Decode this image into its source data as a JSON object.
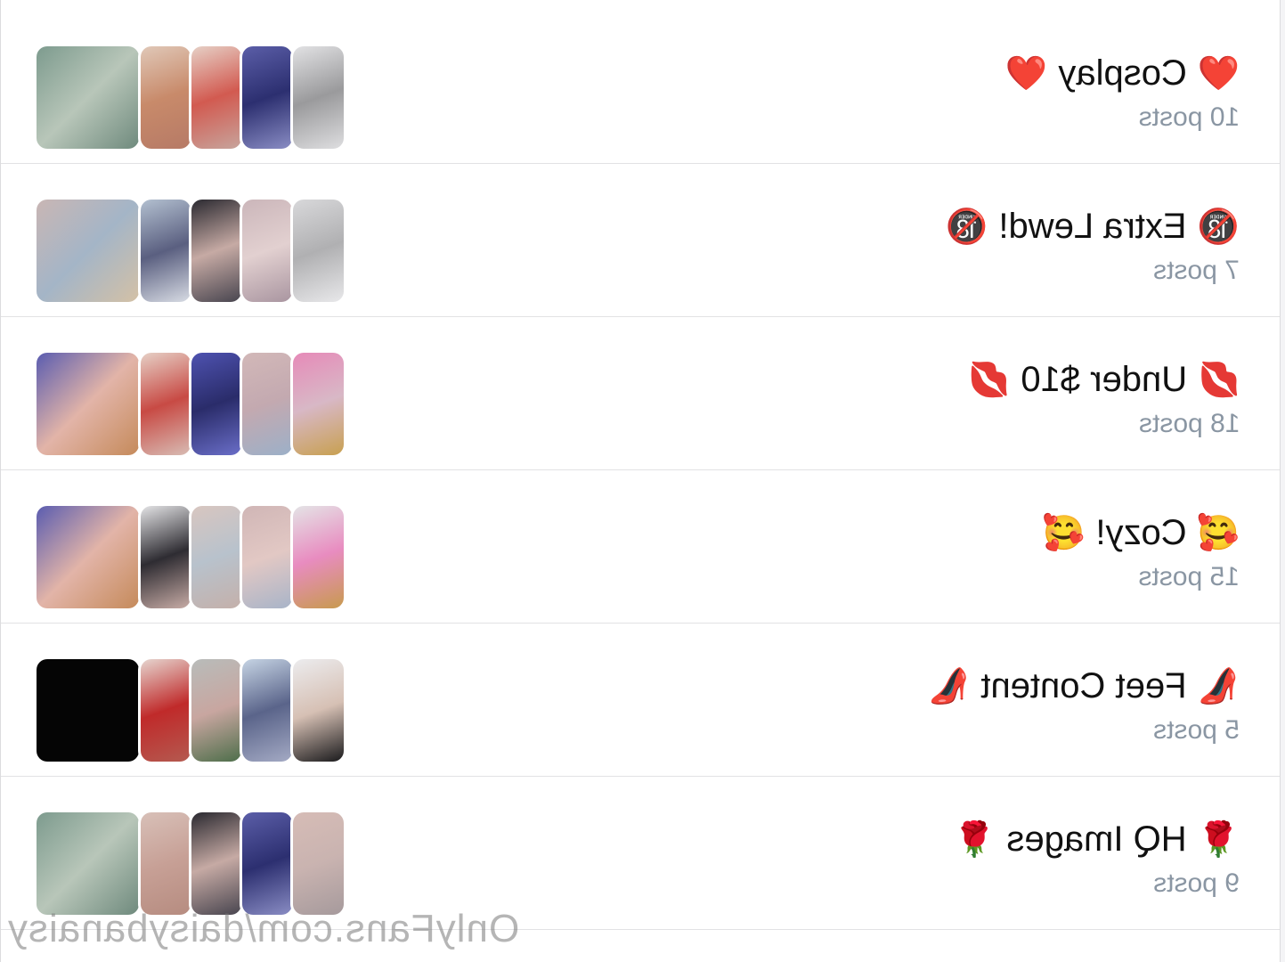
{
  "collections": [
    {
      "title": "Cosplay",
      "emoji": "❤️",
      "count": "10 posts",
      "thumbs": [
        "#8aa59a",
        "#c9a79c",
        "#d8b0a8",
        "#4a4e8a",
        "#cfcfd2"
      ]
    },
    {
      "title": "Extra Lewd!",
      "emoji": "🔞",
      "count": "7 posts",
      "thumbs": [
        "#b7a9a7",
        "#a9b4c4",
        "#3c3a44",
        "#c6b3b8",
        "#d2d2d4"
      ]
    },
    {
      "title": "Under $10",
      "emoji": "💋",
      "count": "18 posts",
      "thumbs": [
        "#9c8ab6",
        "#d6a6a0",
        "#4d4fa0",
        "#c8b2b4",
        "#d8b6c2"
      ]
    },
    {
      "title": "Cozy!",
      "emoji": "🥰",
      "count": "15 posts",
      "thumbs": [
        "#9c8ab6",
        "#4c4c52",
        "#cab8b8",
        "#c7b2b1",
        "#dcbdc8"
      ]
    },
    {
      "title": "Feet Content",
      "emoji": "👠",
      "count": "5 posts",
      "thumbs": [
        "#050505",
        "#b54a4a",
        "#a7aeaa",
        "#9aa6c0",
        "#c0bfc1"
      ]
    },
    {
      "title": "HQ Images",
      "emoji": "🌹",
      "count": "9 posts",
      "thumbs": [
        "#8aa59a",
        "#c4aaa8",
        "#3e3b41",
        "#4a4e8a",
        "#c9b3b0"
      ]
    }
  ],
  "watermark": "OnlyFans.com/daisybanaisy"
}
